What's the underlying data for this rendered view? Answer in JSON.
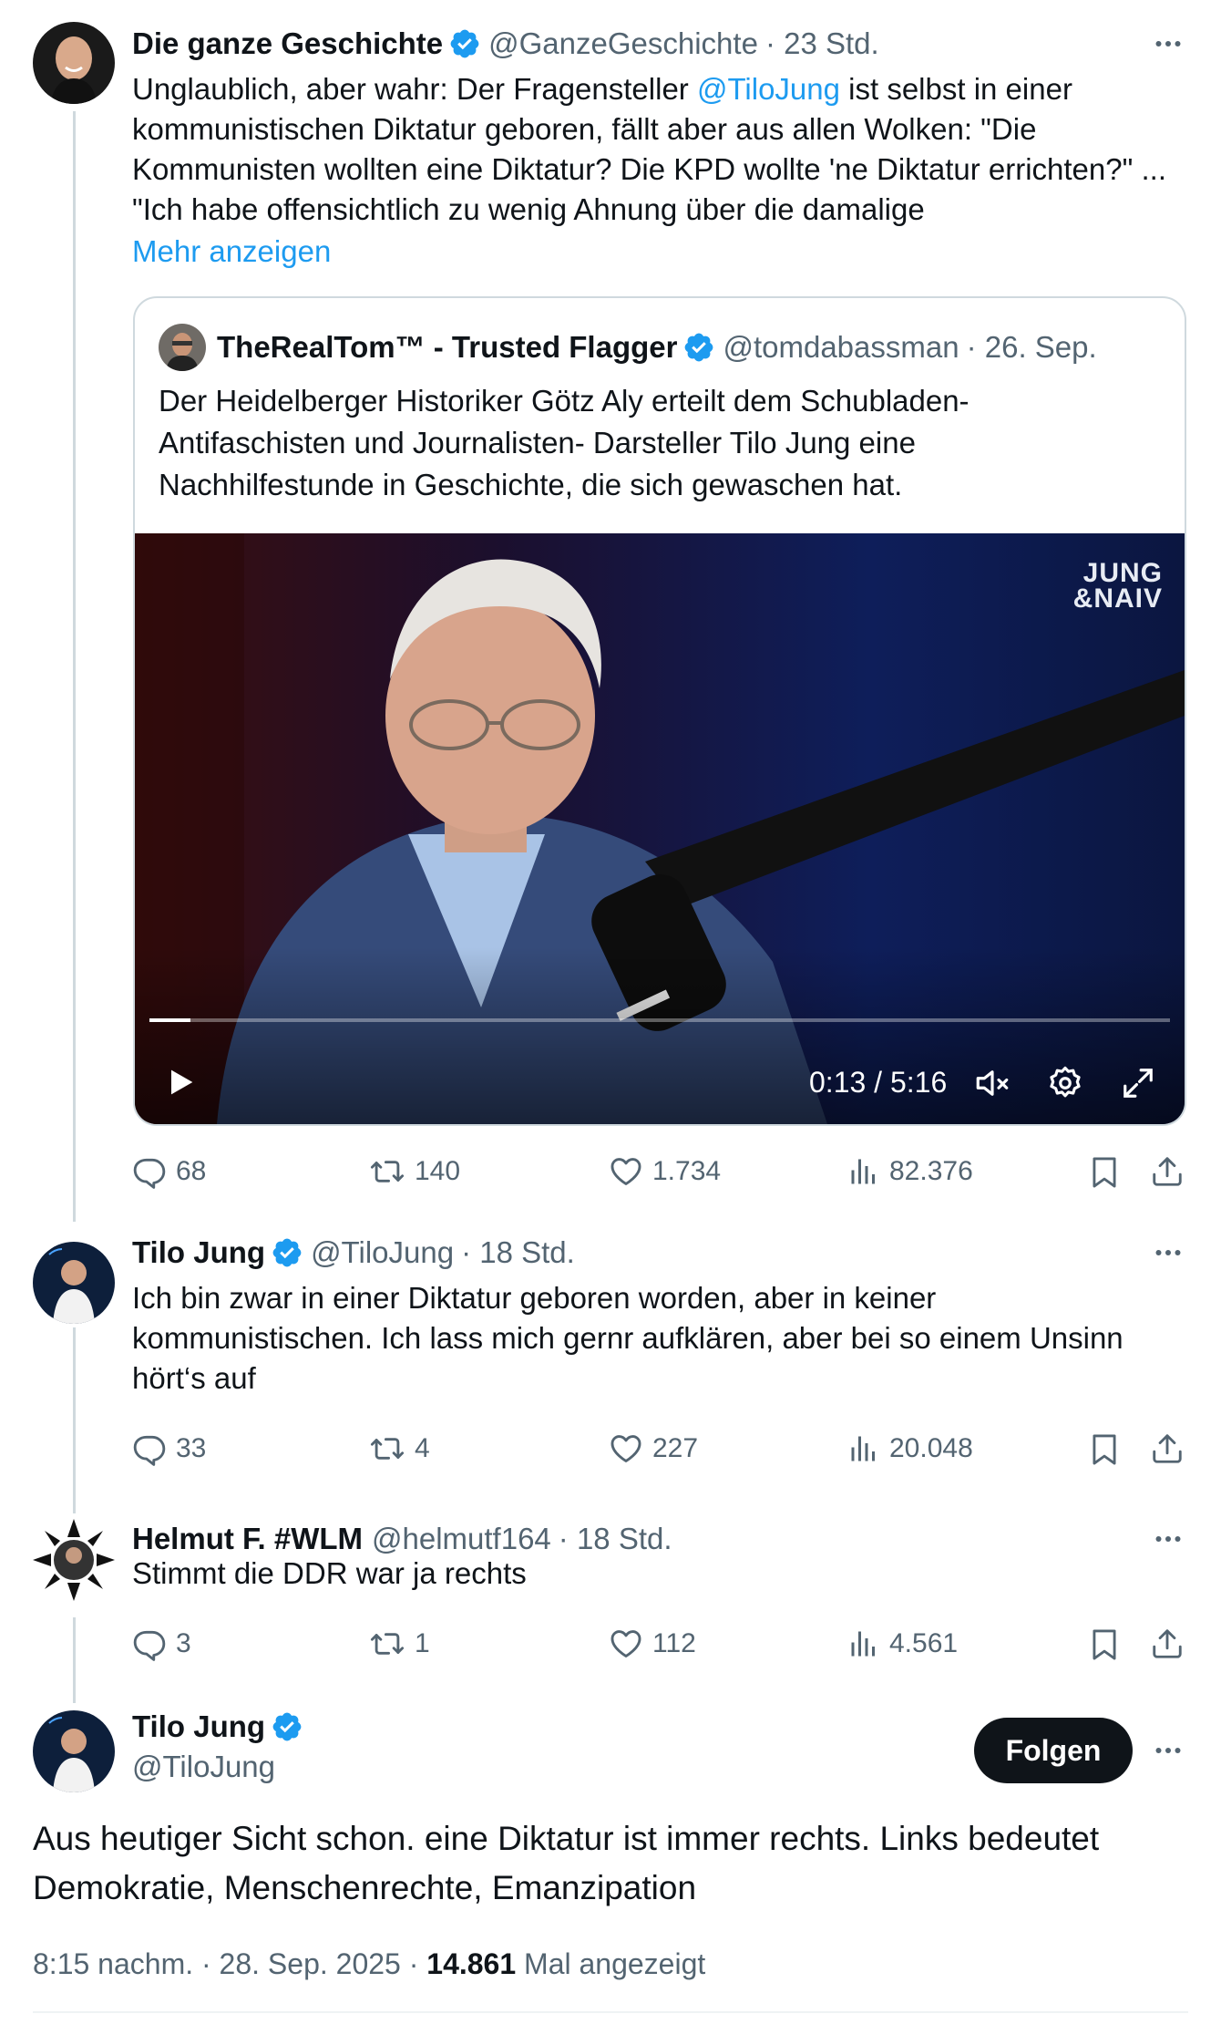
{
  "tweet1": {
    "name": "Die ganze Geschichte",
    "handle": "@GanzeGeschichte",
    "time": "· 23 Std.",
    "text_before": "Unglaublich, aber wahr: Der Fragensteller ",
    "mention": "@TiloJung",
    "text_after": " ist selbst in einer kommunistischen Diktatur geboren, fällt aber aus allen Wolken: \"Die Kommunisten wollten eine Diktatur? Die KPD wollte 'ne Diktatur errichten?\" ... \"Ich habe offensichtlich zu wenig Ahnung über die damalige",
    "show_more": "Mehr anzeigen",
    "quote": {
      "name": "TheRealTom™ - Trusted Flagger",
      "handle": "@tomdabassman",
      "time": "· 26. Sep.",
      "text": "Der Heidelberger Historiker Götz Aly erteilt dem Schubladen-Antifaschisten und Journalisten- Darsteller Tilo Jung eine Nachhilfestunde in Geschichte, die sich gewaschen hat.",
      "video": {
        "watermark_line1": "JUNG",
        "watermark_line2": "&NAIV",
        "time": "0:13 / 5:16",
        "progress": 0.04
      }
    },
    "actions": {
      "replies": "68",
      "reposts": "140",
      "likes": "1.734",
      "views": "82.376"
    }
  },
  "tweet2": {
    "name": "Tilo Jung",
    "handle": "@TiloJung",
    "time": "· 18 Std.",
    "text": "Ich bin zwar in einer Diktatur geboren worden, aber in keiner kommunistischen. Ich lass mich gernr aufklären, aber bei so einem Unsinn hört‘s auf",
    "actions": {
      "replies": "33",
      "reposts": "4",
      "likes": "227",
      "views": "20.048"
    }
  },
  "tweet3": {
    "name": "Helmut F. #WLM",
    "handle": "@helmutf164",
    "time": "· 18 Std.",
    "text": "Stimmt die DDR war ja rechts",
    "actions": {
      "replies": "3",
      "reposts": "1",
      "likes": "112",
      "views": "4.561"
    }
  },
  "main": {
    "name": "Tilo Jung",
    "handle": "@TiloJung",
    "follow_label": "Folgen",
    "text": "Aus heutiger Sicht schon. eine Diktatur ist immer rechts. Links bedeutet Demokratie, Menschenrechte, Emanzipation",
    "timestamp": "8:15 nachm. · 28. Sep. 2025 · ",
    "views_count": "14.861",
    "views_label": " Mal angezeigt"
  },
  "colors": {
    "accent": "#1d9bf0",
    "text": "#0f1419",
    "muted": "#536471",
    "border": "#cfd9de"
  },
  "icons": [
    "verified-badge-icon",
    "more-icon",
    "reply-icon",
    "repost-icon",
    "like-icon",
    "views-icon",
    "bookmark-icon",
    "share-icon",
    "play-icon",
    "mute-icon",
    "settings-icon",
    "fullscreen-icon"
  ]
}
